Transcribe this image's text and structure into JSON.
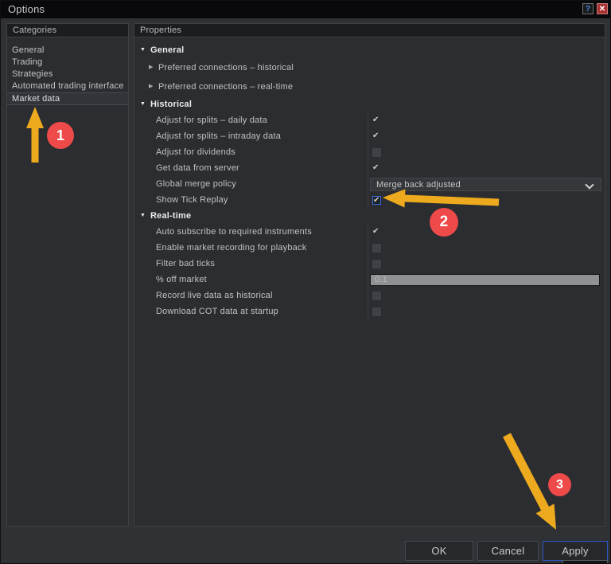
{
  "window": {
    "title": "Options",
    "help_glyph": "?",
    "close_glyph": "✕"
  },
  "sidebar": {
    "header": "Categories",
    "items": [
      {
        "label": "General",
        "selected": false
      },
      {
        "label": "Trading",
        "selected": false
      },
      {
        "label": "Strategies",
        "selected": false
      },
      {
        "label": "Automated trading interface",
        "selected": false
      },
      {
        "label": "Market data",
        "selected": true
      }
    ]
  },
  "properties": {
    "header": "Properties",
    "sections": [
      {
        "label": "General",
        "rows": [
          {
            "label": "Preferred connections – historical",
            "type": "tree"
          },
          {
            "label": "Preferred connections – real-time",
            "type": "tree"
          }
        ]
      },
      {
        "label": "Historical",
        "rows": [
          {
            "label": "Adjust for splits – daily data",
            "type": "checkbox",
            "checked": true
          },
          {
            "label": "Adjust for splits – intraday data",
            "type": "checkbox",
            "checked": true
          },
          {
            "label": "Adjust for dividends",
            "type": "checkbox",
            "checked": false
          },
          {
            "label": "Get data from server",
            "type": "checkbox",
            "checked": true
          },
          {
            "label": "Global merge policy",
            "type": "dropdown",
            "value": "Merge back adjusted"
          },
          {
            "label": "Show Tick Replay",
            "type": "checkbox",
            "checked": true,
            "focused": true
          }
        ]
      },
      {
        "label": "Real-time",
        "rows": [
          {
            "label": "Auto subscribe to required instruments",
            "type": "checkbox",
            "checked": true
          },
          {
            "label": "Enable market recording for playback",
            "type": "checkbox",
            "checked": false
          },
          {
            "label": "Filter bad ticks",
            "type": "checkbox",
            "checked": false
          },
          {
            "label": "% off market",
            "type": "input",
            "value": "0.1",
            "disabled": true
          },
          {
            "label": "Record live data as historical",
            "type": "checkbox",
            "checked": false
          },
          {
            "label": "Download COT data at startup",
            "type": "checkbox",
            "checked": false
          }
        ]
      }
    ]
  },
  "footer": {
    "ok": "OK",
    "cancel": "Cancel",
    "apply": "Apply"
  },
  "icons": {
    "collapse": "▼",
    "expand": "▶",
    "check": "✔"
  },
  "annotations": {
    "steps": [
      "1",
      "2",
      "3"
    ],
    "arrow_color": "#edaa1f",
    "badge_color": "#ee4a49",
    "focus_color": "#2f6fe0"
  }
}
